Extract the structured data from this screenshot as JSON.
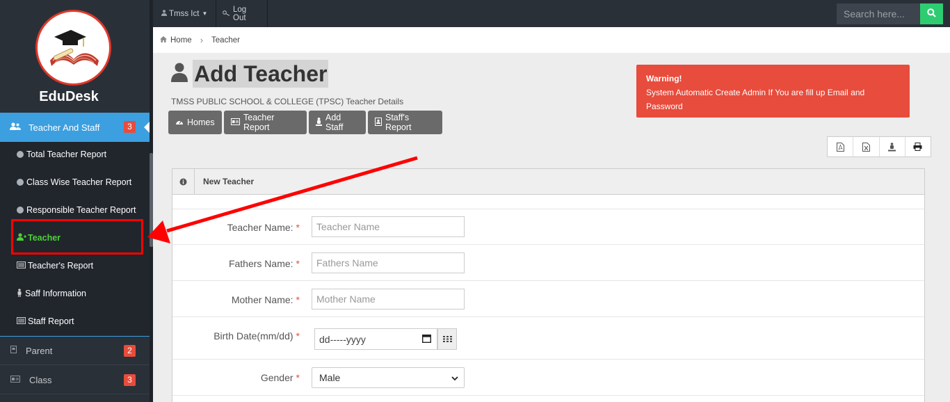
{
  "sidebar": {
    "brand": "EduDesk",
    "active_menu": {
      "label": "Teacher And Staff",
      "badge": "3",
      "icon": "users-icon"
    },
    "submenu": [
      {
        "label": "Total Teacher Report",
        "icon": "circle-icon"
      },
      {
        "label": "Class Wise Teacher Report",
        "icon": "circle-icon"
      },
      {
        "label": "Responsible Teacher Report",
        "icon": "circle-icon"
      },
      {
        "label": "Teacher",
        "icon": "user-plus-icon",
        "active": true
      },
      {
        "label": "Teacher's Report",
        "icon": "list-icon"
      },
      {
        "label": "Saff Information",
        "icon": "person-icon"
      },
      {
        "label": "Staff Report",
        "icon": "list-icon"
      }
    ],
    "menu": [
      {
        "label": "Parent",
        "badge": "2",
        "icon": "document-icon"
      },
      {
        "label": "Class",
        "badge": "3",
        "icon": "id-card-icon"
      }
    ]
  },
  "topbar": {
    "user_label": "Tmss Ict",
    "logout_label": "Log Out",
    "search_placeholder": "Search here..."
  },
  "breadcrumb": {
    "home": "Home",
    "current": "Teacher"
  },
  "header": {
    "title": "Add Teacher",
    "subtitle": "TMSS PUBLIC SCHOOL & COLLEGE (TPSC) Teacher Details",
    "buttons": [
      {
        "label": "Homes",
        "icon": "dashboard-icon"
      },
      {
        "label": "Teacher Report",
        "icon": "id-card-icon"
      },
      {
        "label": "Add Staff",
        "icon": "person-icon"
      },
      {
        "label": "Staff's Report",
        "icon": "document-icon"
      }
    ]
  },
  "warning": {
    "title": "Warning!",
    "message": "System Automatic Create Admin If You are fill up Email and Password"
  },
  "export_icons": [
    "pdf-icon",
    "excel-icon",
    "download-icon",
    "print-icon"
  ],
  "form": {
    "panel_title": "New Teacher",
    "teacher_name": {
      "label": "Teacher Name:",
      "placeholder": "Teacher Name"
    },
    "fathers_name": {
      "label": "Fathers Name:",
      "placeholder": "Fathers Name"
    },
    "mother_name": {
      "label": "Mother Name:",
      "placeholder": "Mother Name"
    },
    "birth_date": {
      "label": "Birth Date(mm/dd)",
      "placeholder": "dd-----yyyy"
    },
    "gender": {
      "label": "Gender",
      "value": "Male"
    },
    "required_mark": "*"
  },
  "colors": {
    "sidebar_bg": "#2a3038",
    "active_blue": "#3c9fe0",
    "badge_red": "#e74c3c",
    "search_green": "#2ecc71",
    "highlight_red": "#ff0000",
    "active_green": "#4cd137"
  }
}
